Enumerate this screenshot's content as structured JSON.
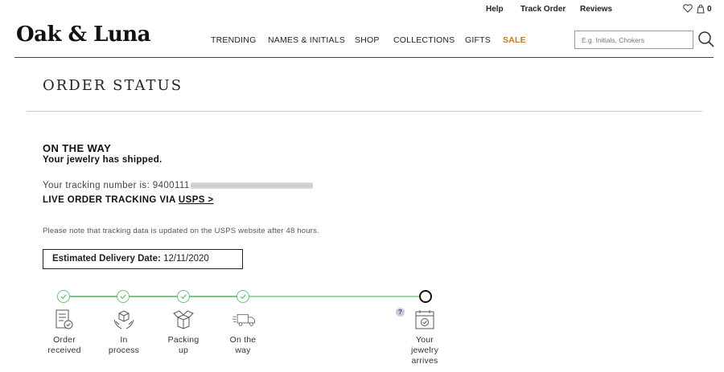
{
  "utility": {
    "help": "Help",
    "track_order": "Track Order",
    "reviews": "Reviews",
    "cart_count": "0"
  },
  "brand": {
    "logo": "Oak & Luna"
  },
  "nav": {
    "items": [
      "TRENDING",
      "NAMES & INITIALS",
      "SHOP",
      "COLLECTIONS",
      "GIFTS"
    ],
    "sale": "SALE"
  },
  "search": {
    "placeholder": "E.g. Initials, Chokers"
  },
  "page": {
    "title": "ORDER STATUS"
  },
  "status": {
    "headline": "ON THE WAY",
    "subline": "Your jewelry has shipped.",
    "tracking_label": "Your tracking number is: 9400111",
    "live_label": "LIVE ORDER TRACKING VIA",
    "live_link": "USPS >",
    "note": "Please note that tracking data is updated on the USPS website after 48 hours.",
    "estimate_label": "Estimated Delivery Date:",
    "estimate_value": "12/11/2020"
  },
  "timeline": {
    "steps": [
      {
        "label": "Order\nreceived",
        "icon": "receipt-icon",
        "complete": true
      },
      {
        "label": "In\nprocess",
        "icon": "hands-box-icon",
        "complete": true
      },
      {
        "label": "Packing\nup",
        "icon": "open-box-icon",
        "complete": true
      },
      {
        "label": "On the\nway",
        "icon": "truck-icon",
        "complete": true
      },
      {
        "label": "Your\njewelry\narrives",
        "icon": "calendar-check-icon",
        "complete": false
      }
    ],
    "help": "?"
  },
  "colors": {
    "sale": "#c07a1c",
    "progress": "#6cbf7c"
  }
}
